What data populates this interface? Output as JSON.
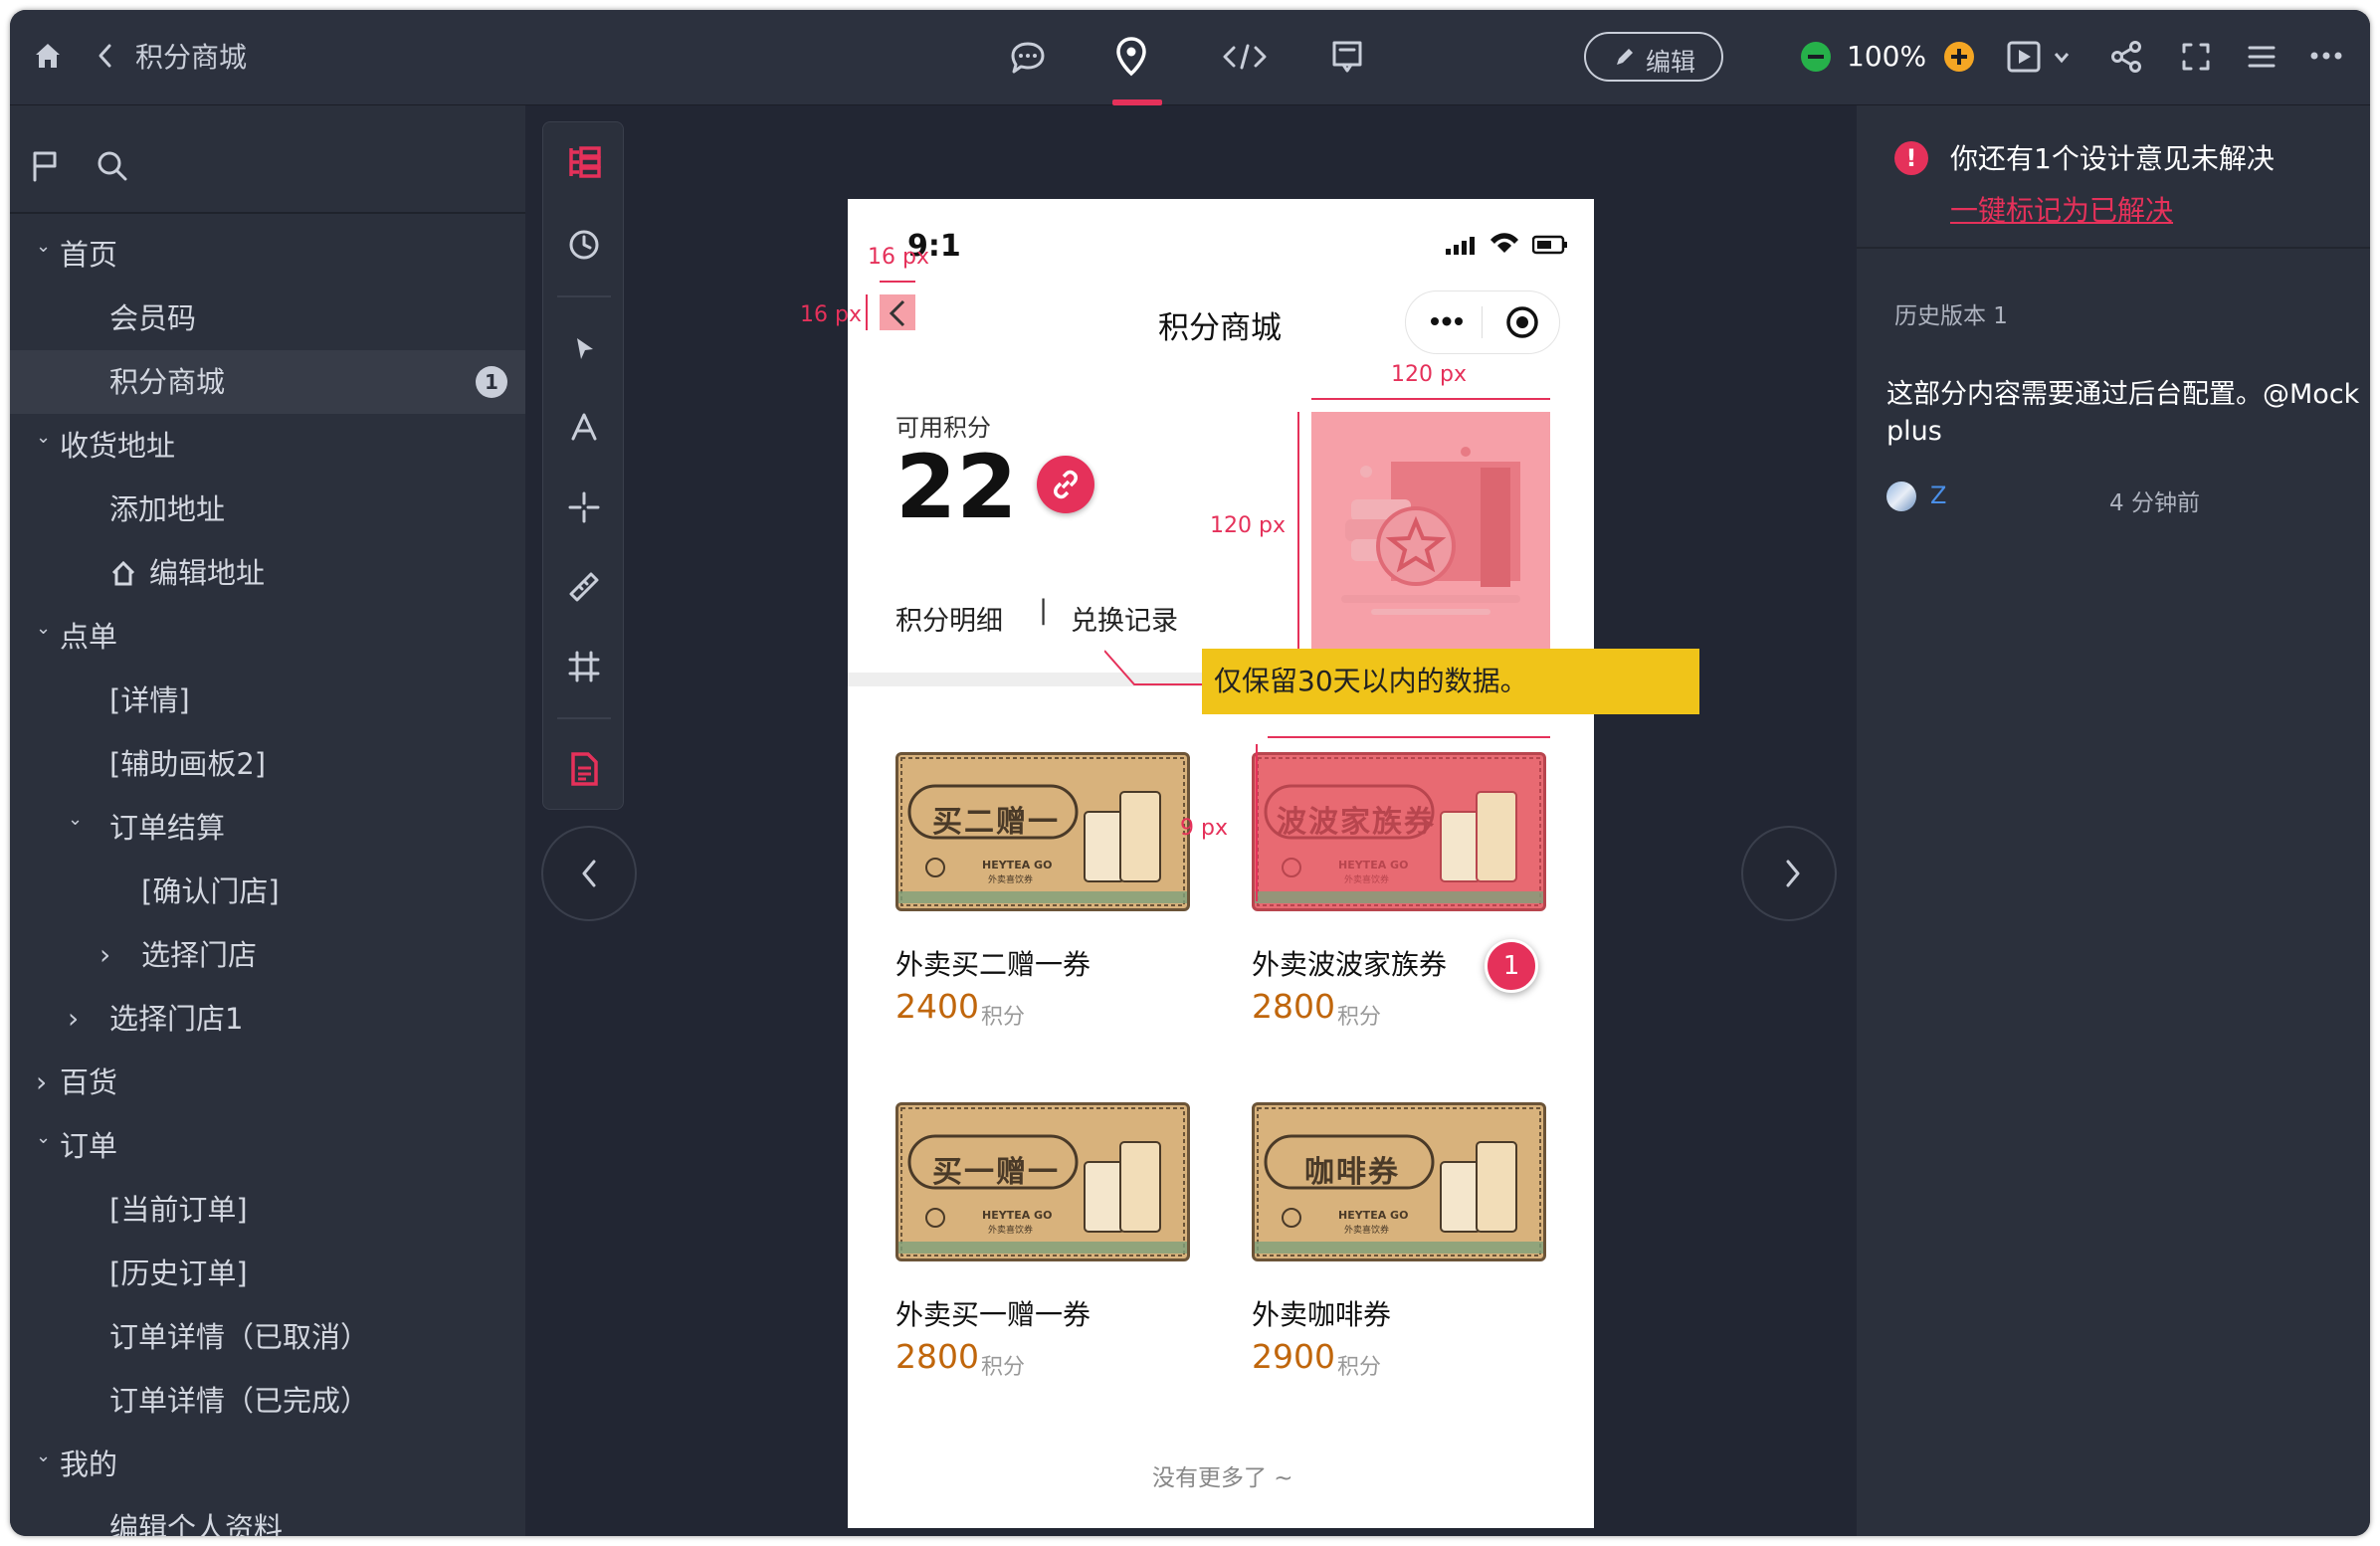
{
  "topbar": {
    "back_title": "积分商城",
    "edit_label": "编辑",
    "zoom": "100%"
  },
  "sidebar": {
    "items": [
      {
        "label": "首页",
        "level": 0,
        "caret": "down"
      },
      {
        "label": "会员码",
        "level": 1
      },
      {
        "label": "积分商城",
        "level": 1,
        "selected": true,
        "badge": "1"
      },
      {
        "label": "收货地址",
        "level": 0,
        "caret": "down"
      },
      {
        "label": "添加地址",
        "level": 1
      },
      {
        "label": "编辑地址",
        "level": 1,
        "home_icon": true
      },
      {
        "label": "点单",
        "level": 0,
        "caret": "down"
      },
      {
        "label": "[详情]",
        "level": 1
      },
      {
        "label": "[辅助画板2]",
        "level": 1
      },
      {
        "label": "订单结算",
        "level": 1,
        "caret": "down"
      },
      {
        "label": "[确认门店]",
        "level": 2
      },
      {
        "label": "选择门店",
        "level": 2,
        "caret": "right"
      },
      {
        "label": "选择门店1",
        "level": 1,
        "caret": "right"
      },
      {
        "label": "百货",
        "level": 0,
        "caret": "right"
      },
      {
        "label": "订单",
        "level": 0,
        "caret": "down"
      },
      {
        "label": "[当前订单]",
        "level": 1
      },
      {
        "label": "[历史订单]",
        "level": 1
      },
      {
        "label": "订单详情（已取消）",
        "level": 1
      },
      {
        "label": "订单详情（已完成）",
        "level": 1
      },
      {
        "label": "我的",
        "level": 0,
        "caret": "down"
      },
      {
        "label": "编辑个人资料",
        "level": 1
      }
    ]
  },
  "phone": {
    "time": "9:1",
    "title": "积分商城",
    "points_label": "可用积分",
    "points_value": "22",
    "tab_detail": "积分明细",
    "tab_separator": "|",
    "tab_records": "兑换记录",
    "tooltip": "仅保留30天以内的数据。",
    "products": [
      {
        "name": "外卖买二赠一券",
        "price": "2400",
        "unit": "积分",
        "banner": "买二赠一",
        "brand": "HEYTEA GO",
        "brand_sub": "外卖喜饮券"
      },
      {
        "name": "外卖波波家族券",
        "price": "2800",
        "unit": "积分",
        "banner": "波波家族券",
        "brand": "HEYTEA GO",
        "brand_sub": "外卖喜饮券"
      },
      {
        "name": "外卖买一赠一券",
        "price": "2800",
        "unit": "积分",
        "banner": "买一赠一",
        "brand": "HEYTEA GO",
        "brand_sub": "外卖喜饮券"
      },
      {
        "name": "外卖咖啡券",
        "price": "2900",
        "unit": "积分",
        "banner": "咖啡券",
        "brand": "HEYTEA GO",
        "brand_sub": "外卖喜饮券"
      }
    ],
    "footer": "没有更多了 ~",
    "comment_pin": "1"
  },
  "measures": {
    "m16a": "16 px",
    "m16b": "16 px",
    "m120w": "120 px",
    "m120h": "120 px",
    "m_row_top": "",
    "m9": "9 px"
  },
  "right_panel": {
    "alert_text": "你还有1个设计意见未解决",
    "resolve_link": "一键标记为已解决",
    "history_label": "历史版本 1",
    "comment_line1": "这部分内容需要通过后台配置。@Mock",
    "comment_line2": "plus",
    "user": "Z",
    "time_ago": "4 分钟前"
  },
  "colors": {
    "accent": "#e5315a",
    "price": "#c0660c",
    "tooltip": "#f0c419",
    "dark_bg": "#222633"
  }
}
